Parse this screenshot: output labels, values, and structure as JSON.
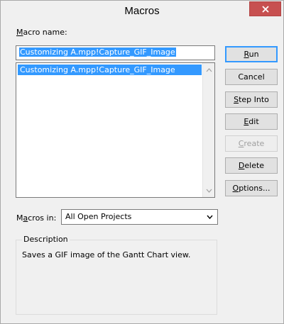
{
  "window": {
    "title": "Macros",
    "close_icon": "close-icon"
  },
  "macro_name": {
    "label_accel": "M",
    "label_rest": "acro name:",
    "value": "Customizing A.mpp!Capture_GIF_Image"
  },
  "macro_list": {
    "items": [
      "Customizing A.mpp!Capture_GIF_Image"
    ]
  },
  "buttons": [
    {
      "accel": "R",
      "rest": "un",
      "pre": "",
      "enabled": true,
      "default": true
    },
    {
      "accel": "",
      "rest": "Cancel",
      "pre": "",
      "enabled": true,
      "default": false
    },
    {
      "accel": "S",
      "rest": "tep Into",
      "pre": "",
      "enabled": true,
      "default": false
    },
    {
      "accel": "E",
      "rest": "dit",
      "pre": "",
      "enabled": true,
      "default": false
    },
    {
      "accel": "C",
      "rest": "reate",
      "pre": "",
      "enabled": false,
      "default": false
    },
    {
      "accel": "D",
      "rest": "elete",
      "pre": "",
      "enabled": true,
      "default": false
    },
    {
      "accel": "O",
      "rest": "ptions...",
      "pre": "",
      "enabled": true,
      "default": false
    }
  ],
  "macros_in": {
    "label_pre": "M",
    "label_accel": "a",
    "label_rest": "cros in:",
    "selected": "All Open Projects"
  },
  "description": {
    "legend": "Description",
    "text": "Saves a GIF image of the Gantt Chart view."
  }
}
